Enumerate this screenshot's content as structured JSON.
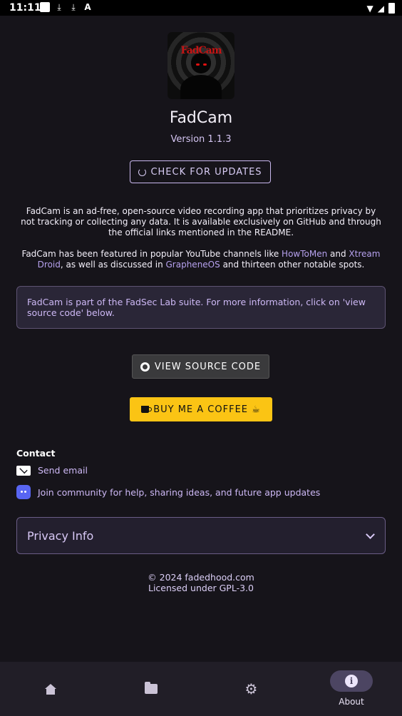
{
  "status_bar": {
    "time": "11:11"
  },
  "app": {
    "logo_text": "FadCam",
    "title": "FadCam",
    "version": "Version 1.1.3"
  },
  "actions": {
    "check_updates": "CHECK FOR UPDATES",
    "view_source": "VIEW SOURCE CODE",
    "buy_coffee": "BUY ME A COFFEE ☕"
  },
  "description": {
    "para1": "FadCam is an ad-free, open-source video recording app that prioritizes privacy by not tracking or collecting any data. It is available exclusively on GitHub and through the official links mentioned in the README.",
    "para2_a": "FadCam has been featured in popular YouTube channels like ",
    "link_howtomen": "HowToMen",
    "para2_b": " and ",
    "link_xtreamdroid": "Xtream Droid",
    "para2_c": ", as well as discussed in ",
    "link_grapheneos": "GrapheneOS",
    "para2_d": " and thirteen other notable spots."
  },
  "info_box": {
    "text": "FadCam is part of the FadSec Lab suite. For more information, click on 'view source code' below."
  },
  "contact": {
    "heading": "Contact",
    "email_label": "Send email",
    "community_label": "Join community for help, sharing ideas, and future app updates"
  },
  "privacy": {
    "title": "Privacy Info"
  },
  "footer": {
    "copyright": "© 2024 fadedhood.com",
    "license": "Licensed under GPL-3.0"
  },
  "bottom_nav": {
    "items": [
      {
        "icon": "home-icon"
      },
      {
        "icon": "folder-icon"
      },
      {
        "icon": "settings-icon"
      },
      {
        "icon": "info-icon",
        "label": "About",
        "active": true
      }
    ]
  },
  "colors": {
    "background": "#16141a",
    "accent": "#cdb8f5",
    "coffee_button": "#fbc414",
    "nav_bar": "#211e27"
  }
}
